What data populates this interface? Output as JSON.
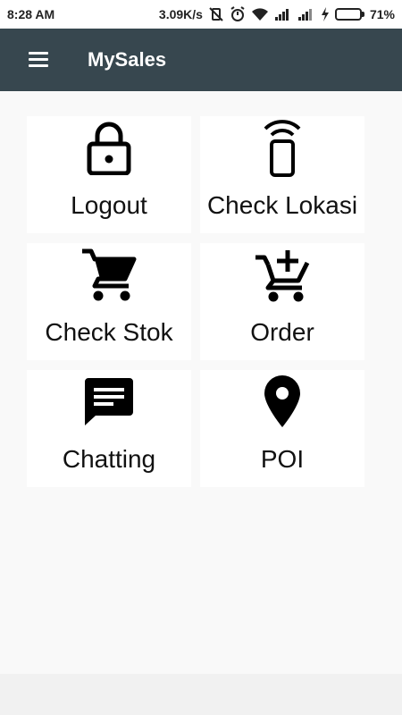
{
  "status_bar": {
    "time": "8:28 AM",
    "speed": "3.09K/s",
    "battery_percent": "71%",
    "battery_level": 0.71,
    "icons": [
      "vibrate-off-icon",
      "alarm-icon",
      "wifi-icon",
      "signal-icon",
      "signal-icon",
      "charging-icon",
      "battery-icon"
    ]
  },
  "app_bar": {
    "menu_icon": "hamburger-menu-icon",
    "title": "MySales"
  },
  "menu": {
    "tiles": [
      {
        "label": "Logout",
        "icon": "lock-icon"
      },
      {
        "label": "Check Lokasi",
        "icon": "phone-signal-icon"
      },
      {
        "label": "Check Stok",
        "icon": "shopping-cart-icon"
      },
      {
        "label": "Order",
        "icon": "add-cart-icon"
      },
      {
        "label": "Chatting",
        "icon": "chat-icon"
      },
      {
        "label": "POI",
        "icon": "map-pin-icon"
      }
    ]
  },
  "colors": {
    "app_bar": "#37474f",
    "background": "#f9f9f9",
    "tile": "#ffffff",
    "battery": "#4caf50"
  }
}
